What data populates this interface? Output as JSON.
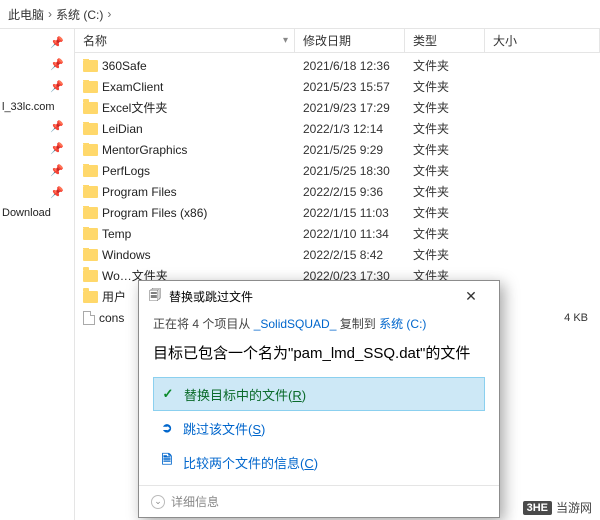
{
  "breadcrumb": {
    "part1": "此电脑",
    "sep": "›",
    "part2": "系统 (C:)"
  },
  "sidebar": {
    "item1": "l_33lc.com",
    "item2": "Download"
  },
  "pin_glyph": "📌",
  "headers": {
    "name": "名称",
    "date": "修改日期",
    "type": "类型",
    "size": "大小"
  },
  "sort_glyph": "▾",
  "rows": [
    {
      "name": "360Safe",
      "date": "2021/6/18 12:36",
      "type": "文件夹",
      "size": "",
      "kind": "folder"
    },
    {
      "name": "ExamClient",
      "date": "2021/5/23 15:57",
      "type": "文件夹",
      "size": "",
      "kind": "folder"
    },
    {
      "name": "Excel文件夹",
      "date": "2021/9/23 17:29",
      "type": "文件夹",
      "size": "",
      "kind": "folder"
    },
    {
      "name": "LeiDian",
      "date": "2022/1/3 12:14",
      "type": "文件夹",
      "size": "",
      "kind": "folder"
    },
    {
      "name": "MentorGraphics",
      "date": "2021/5/25 9:29",
      "type": "文件夹",
      "size": "",
      "kind": "folder"
    },
    {
      "name": "PerfLogs",
      "date": "2021/5/25 18:30",
      "type": "文件夹",
      "size": "",
      "kind": "folder"
    },
    {
      "name": "Program Files",
      "date": "2022/2/15 9:36",
      "type": "文件夹",
      "size": "",
      "kind": "folder"
    },
    {
      "name": "Program Files (x86)",
      "date": "2022/1/15 11:03",
      "type": "文件夹",
      "size": "",
      "kind": "folder"
    },
    {
      "name": "Temp",
      "date": "2022/1/10 11:34",
      "type": "文件夹",
      "size": "",
      "kind": "folder"
    },
    {
      "name": "Windows",
      "date": "2022/2/15 8:42",
      "type": "文件夹",
      "size": "",
      "kind": "folder"
    },
    {
      "name": "Wo…文件夹",
      "date": "2022/0/23 17:30",
      "type": "文件夹",
      "size": "",
      "kind": "folder"
    },
    {
      "name": "用户",
      "date": "",
      "type": "",
      "size": "",
      "kind": "folder"
    },
    {
      "name": "cons",
      "date": "",
      "type": "",
      "size": "4 KB",
      "kind": "file"
    }
  ],
  "dialog": {
    "title": "替换或跳过文件",
    "status_pre": "正在将 4 个项目从 ",
    "status_src": "_SolidSQUAD_",
    "status_mid": " 复制到 ",
    "status_dst": "系统 (C:)",
    "message": "目标已包含一个名为\"pam_lmd_SSQ.dat\"的文件",
    "opt1": "替换目标中的文件(",
    "opt1_acc": "R",
    "opt1_end": ")",
    "opt2": "跳过该文件(",
    "opt2_acc": "S",
    "opt2_end": ")",
    "opt3": "比较两个文件的信息(",
    "opt3_acc": "C",
    "opt3_end": ")",
    "details": "详细信息",
    "close": "✕"
  },
  "icons": {
    "check": "✓",
    "skip": "➲",
    "compare": "🗎",
    "copy": "🗐",
    "chev": "⌄"
  },
  "watermark": {
    "logo": "3HE",
    "text": "当游网"
  }
}
